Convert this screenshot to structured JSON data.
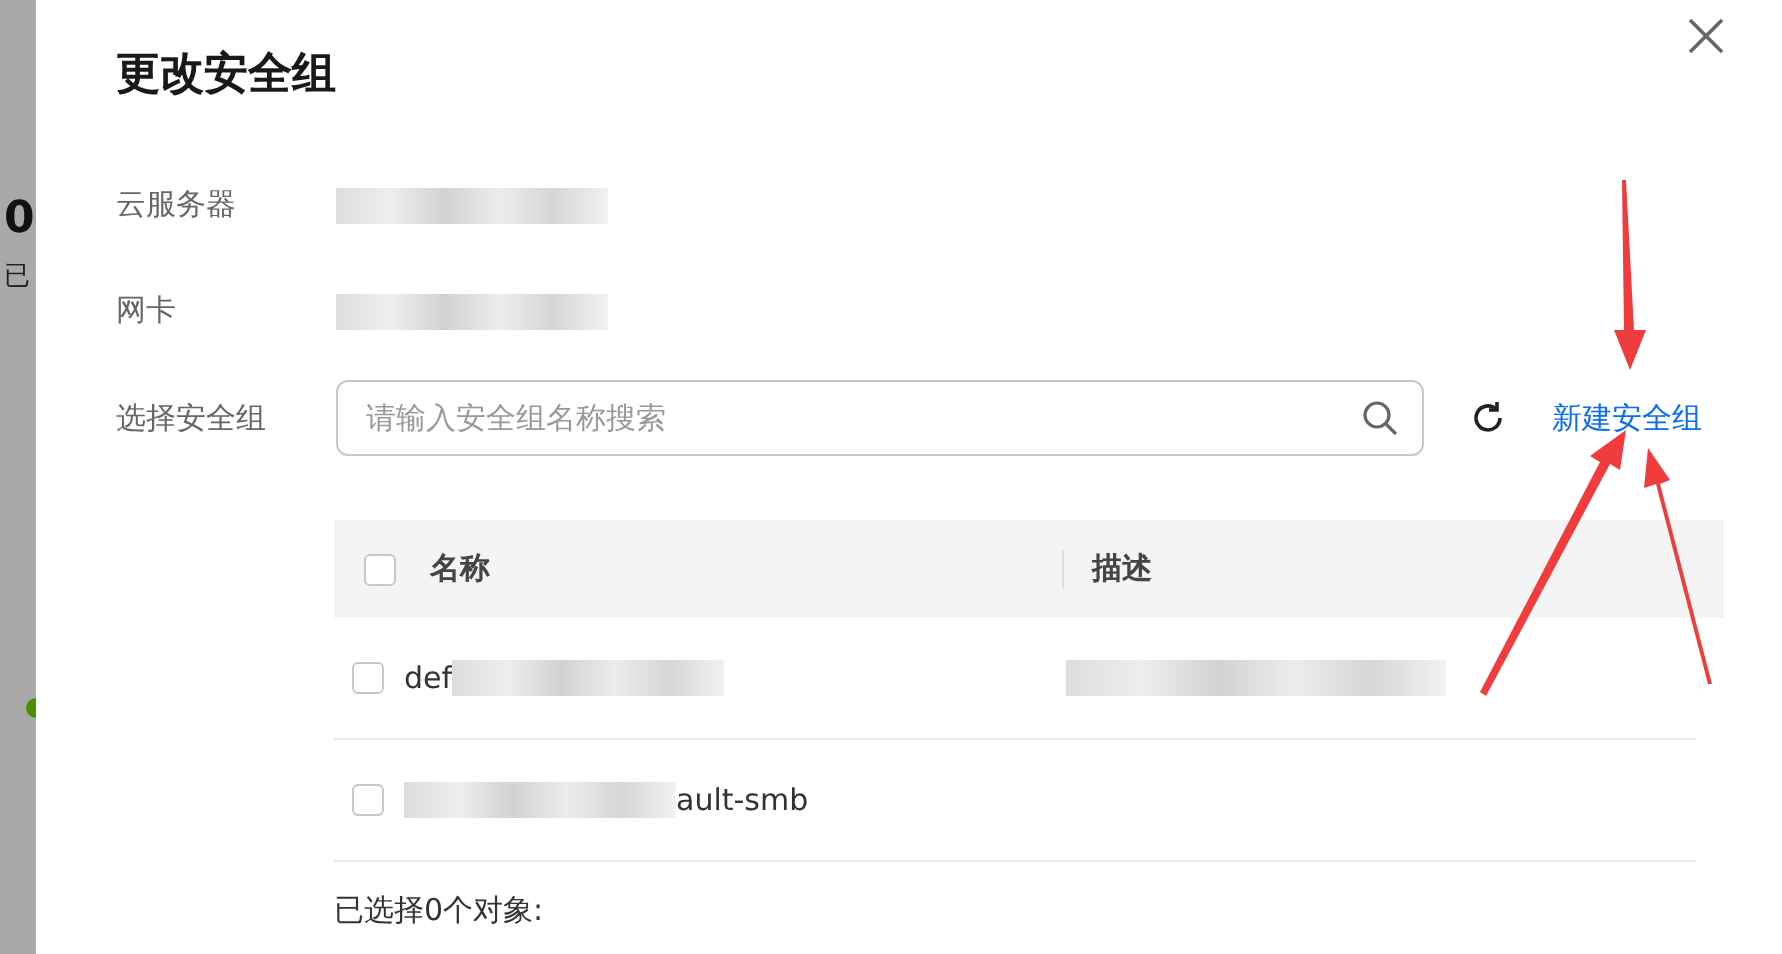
{
  "background": {
    "value": "0",
    "caption": "已"
  },
  "dialog": {
    "title": "更改安全组",
    "fields": [
      {
        "label": "云服务器"
      },
      {
        "label": "网卡"
      }
    ],
    "search": {
      "label": "选择安全组",
      "placeholder": "请输入安全组名称搜索"
    },
    "create_link": "新建安全组",
    "table": {
      "select_all": {
        "checked": false
      },
      "columns": [
        "名称",
        "描述"
      ],
      "rows": [
        {
          "checked": false,
          "name": "def"
        },
        {
          "checked": false,
          "name": "ault-smb"
        }
      ]
    },
    "footer": "已选择0个对象:"
  }
}
